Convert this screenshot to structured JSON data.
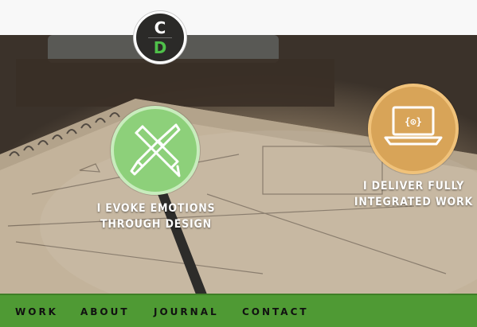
{
  "logo": {
    "top_letter": "C",
    "bottom_letter": "D"
  },
  "features": [
    {
      "icon": "pencil-brush-icon",
      "line1": "I EVOKE EMOTIONS",
      "line2": "THROUGH DESIGN",
      "color": "#8dd07a"
    },
    {
      "icon": "laptop-code-icon",
      "line1": "I DELIVER FULLY",
      "line2": "INTEGRATED WORK",
      "color": "#d8a458"
    }
  ],
  "laptop_screen_text": "{⊙}",
  "nav": {
    "items": [
      "WORK",
      "ABOUT",
      "JOURNAL",
      "CONTACT"
    ],
    "background": "#4f9a34"
  },
  "colors": {
    "accent_green": "#4fc04a",
    "logo_bg": "#2b2a28"
  }
}
